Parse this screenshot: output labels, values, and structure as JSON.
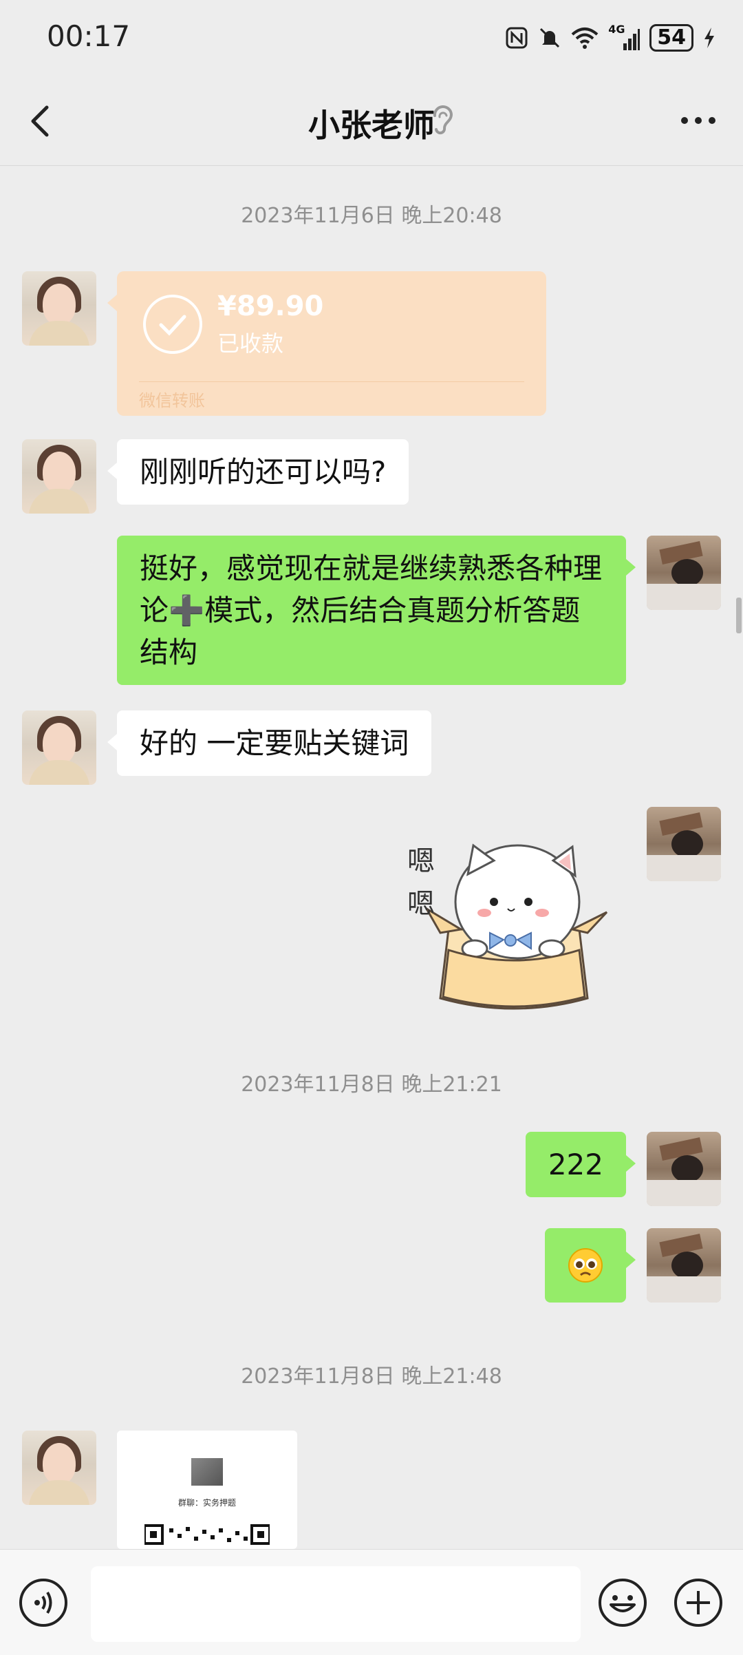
{
  "status_bar": {
    "time": "00:17",
    "network": "4G",
    "battery": "54",
    "icons": [
      "nfc-icon",
      "mute-icon",
      "wifi-icon",
      "signal-icon",
      "battery-icon",
      "charging-icon"
    ]
  },
  "header": {
    "title": "小张老师",
    "back_icon": "back-chevron-icon",
    "mode_icon": "ear-icon",
    "more_icon": "more-dots-icon"
  },
  "timestamps": [
    "2023年11月6日 晚上20:48",
    "2023年11月8日 晚上21:21",
    "2023年11月8日 晚上21:48"
  ],
  "messages": [
    {
      "side": "left",
      "type": "transfer",
      "amount": "¥89.90",
      "status": "已收款",
      "label": "微信转账"
    },
    {
      "side": "left",
      "type": "text",
      "text": "刚刚听的还可以吗?"
    },
    {
      "side": "right",
      "type": "text",
      "text": "挺好，感觉现在就是继续熟悉各种理论➕模式，然后结合真题分析答题结构"
    },
    {
      "side": "left",
      "type": "text",
      "text": "好的 一定要贴关键词"
    },
    {
      "side": "right",
      "type": "sticker",
      "text": "嗯 嗯"
    },
    {
      "side": "right",
      "type": "text",
      "text": "222"
    },
    {
      "side": "right",
      "type": "emoji",
      "text": "🥺"
    },
    {
      "side": "left",
      "type": "qr",
      "text": "群聊：实务押题"
    }
  ],
  "input_bar": {
    "voice_icon": "voice-icon",
    "emoji_icon": "emoji-face-icon",
    "plus_icon": "plus-icon",
    "placeholder": ""
  },
  "colors": {
    "background": "#ededed",
    "bubble_green": "#95ec69",
    "bubble_white": "#ffffff",
    "transfer": "#fbdfc3"
  }
}
